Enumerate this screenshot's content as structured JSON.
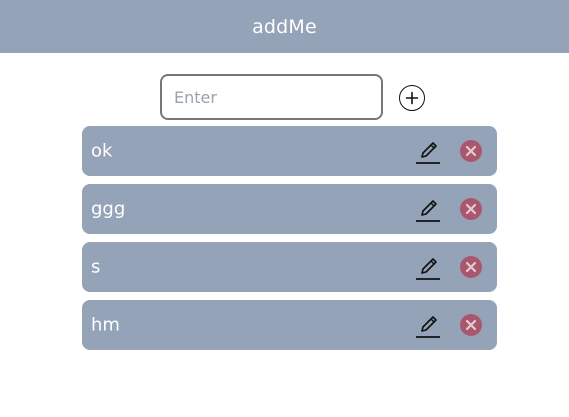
{
  "app": {
    "title": "addMe"
  },
  "input": {
    "value": "",
    "placeholder": "Enter"
  },
  "todos": [
    {
      "label": "ok"
    },
    {
      "label": "ggg"
    },
    {
      "label": "s"
    },
    {
      "label": "hm"
    }
  ],
  "icons": {
    "add": "plus-circle-icon",
    "edit": "pencil-icon",
    "delete": "x-circle-icon"
  },
  "colors": {
    "header_bg": "#94a3b7",
    "item_bg": "#94a3b7",
    "delete": "#a8576d",
    "text_on_accent": "#ffffff"
  }
}
